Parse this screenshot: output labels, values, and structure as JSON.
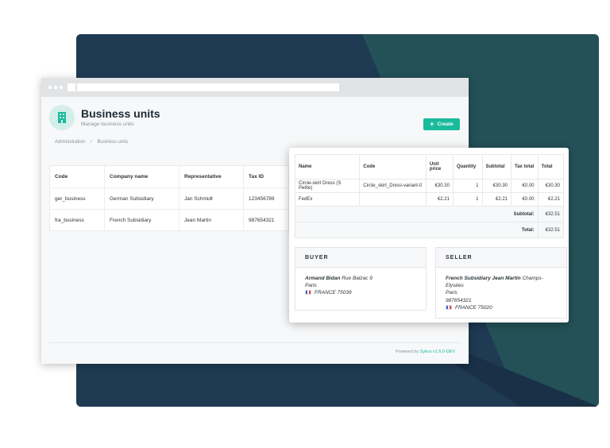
{
  "window": {
    "title": "Business units",
    "subtitle": "Manage business units",
    "create_label": "Create"
  },
  "breadcrumb": {
    "root": "Administration",
    "separator": ">",
    "current": "Business units"
  },
  "list_table": {
    "headers": [
      "Code",
      "Company name",
      "Representative",
      "Tax ID"
    ],
    "rows": [
      [
        "ger_business",
        "German Subsidiary",
        "Jan Schmidt",
        "123456789"
      ],
      [
        "fra_business",
        "French Subsidiary",
        "Jean Martin",
        "987654321"
      ]
    ]
  },
  "footer": {
    "powered_prefix": "Powered by",
    "powered_link": "Sylius v1.6.0-DEV"
  },
  "order": {
    "headers": {
      "name": "Name",
      "code": "Code",
      "unit_price_1": "Unit",
      "unit_price_2": "price",
      "quantity": "Quantity",
      "subtotal": "Subtotal",
      "tax_total": "Tax total",
      "total": "Total"
    },
    "items": [
      {
        "name": "Circle-skirt Dress (S Petite)",
        "code": "Circle_skirt_Dress-variant-0",
        "unit_price": "€30.30",
        "quantity": "1",
        "subtotal": "€30.30",
        "tax_total": "€0.00",
        "total": "€30.30"
      },
      {
        "name": "FedEx",
        "code": "",
        "unit_price": "€2.21",
        "quantity": "1",
        "subtotal": "€2.21",
        "tax_total": "€0.00",
        "total": "€2.21"
      }
    ],
    "subtotal_label": "Subtotal:",
    "subtotal_value": "€32.51",
    "total_label": "Total:",
    "total_value": "€32.51"
  },
  "buyer": {
    "heading": "BUYER",
    "name": "Armand Bidan",
    "street": "Rue Balzac 9",
    "city": "Paris",
    "country": "FRANCE 75039"
  },
  "seller": {
    "heading": "SELLER",
    "company": "French Subsidiary",
    "name": "Jean Martin",
    "street": "Champs-Elysées",
    "city": "Paris",
    "tax_id": "987654321",
    "country": "FRANCE 75020"
  },
  "colors": {
    "accent": "#1abb9c",
    "backdrop_dark": "#1f3b54",
    "backdrop_teal": "#245157"
  }
}
